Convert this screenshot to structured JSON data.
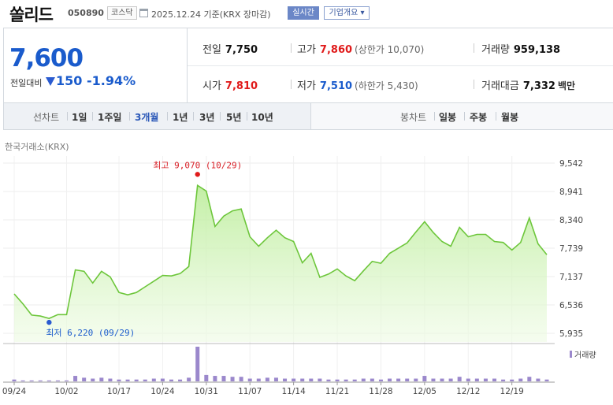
{
  "header": {
    "stock_name": "쏠리드",
    "stock_code": "050890",
    "market_badge": "코스닥",
    "date_label": "2025.12.24  기준(KRX 장마감)",
    "realtime_button": "실시간",
    "overview_button": "기업개요 ▾"
  },
  "price": {
    "current": "7,600",
    "compare_label": "전일대비",
    "change": "150",
    "change_pct": "-1.94%",
    "direction_icon": "down-triangle-icon"
  },
  "stats": {
    "prev_close_label": "전일",
    "prev_close": "7,750",
    "high_label": "고가",
    "high": "7,860",
    "upper_limit": "(상한가 10,070)",
    "volume_label": "거래량",
    "volume": "959,138",
    "open_label": "시가",
    "open": "7,810",
    "low_label": "저가",
    "low": "7,510",
    "lower_limit": "(하한가 5,430)",
    "amount_label": "거래대금",
    "amount": "7,332",
    "amount_unit": "백만"
  },
  "period_bar": {
    "line_label": "선차트",
    "line_periods": [
      "1일",
      "1주일",
      "3개월",
      "1년",
      "3년",
      "5년",
      "10년"
    ],
    "selected": "3개월",
    "candle_label": "봉차트",
    "candle_periods": [
      "일봉",
      "주봉",
      "월봉"
    ]
  },
  "source_label": "한국거래소(KRX)",
  "colors": {
    "accent_blue": "#1a5bcc",
    "up_red": "#e01b1b",
    "line_green": "#6dc63b",
    "volume_purple": "#9b88cc"
  },
  "chart_data": {
    "type": "area",
    "y_ticks": [
      9542,
      8941,
      8340,
      7739,
      7137,
      6536,
      5935
    ],
    "y_tick_labels": [
      "9,542",
      "8,941",
      "8,340",
      "7,739",
      "7,137",
      "6,536",
      "5,935"
    ],
    "ylim": [
      5935,
      9542
    ],
    "x_tick_labels": [
      "09/24",
      "10/02",
      "10/17",
      "10/24",
      "10/31",
      "11/07",
      "11/14",
      "11/21",
      "11/28",
      "12/05",
      "12/12",
      "12/19"
    ],
    "high_annotation": "최고 9,070 (10/29)",
    "low_annotation": "최저 6,220 (09/29)",
    "grid": true,
    "volume_legend": "거래량",
    "series": [
      {
        "values": [
          6770,
          6560,
          6320,
          6300,
          6250,
          6330,
          6330,
          7280,
          7250,
          7000,
          7250,
          7130,
          6800,
          6750,
          6800,
          6920,
          7040,
          7160,
          7150,
          7200,
          7350,
          9070,
          8950,
          8200,
          8420,
          8530,
          8570,
          7980,
          7780,
          7960,
          8120,
          7960,
          7880,
          7430,
          7630,
          7120,
          7190,
          7300,
          7150,
          7050,
          7260,
          7460,
          7420,
          7630,
          7740,
          7850,
          8080,
          8300,
          8070,
          7880,
          7780,
          8180,
          7980,
          8030,
          8030,
          7880,
          7860,
          7700,
          7860,
          8380,
          7830,
          7600
        ]
      }
    ],
    "volume_values": [
      2,
      1,
      1,
      1,
      1,
      1,
      1,
      6,
      4,
      3,
      4,
      3,
      2,
      2,
      2,
      2,
      3,
      3,
      2,
      2,
      4,
      38,
      7,
      6,
      6,
      5,
      5,
      3,
      3,
      4,
      4,
      3,
      3,
      3,
      3,
      3,
      2,
      2,
      2,
      2,
      3,
      3,
      2,
      3,
      3,
      3,
      3,
      6,
      3,
      3,
      3,
      5,
      3,
      3,
      3,
      3,
      2,
      2,
      3,
      5,
      3,
      2
    ]
  }
}
